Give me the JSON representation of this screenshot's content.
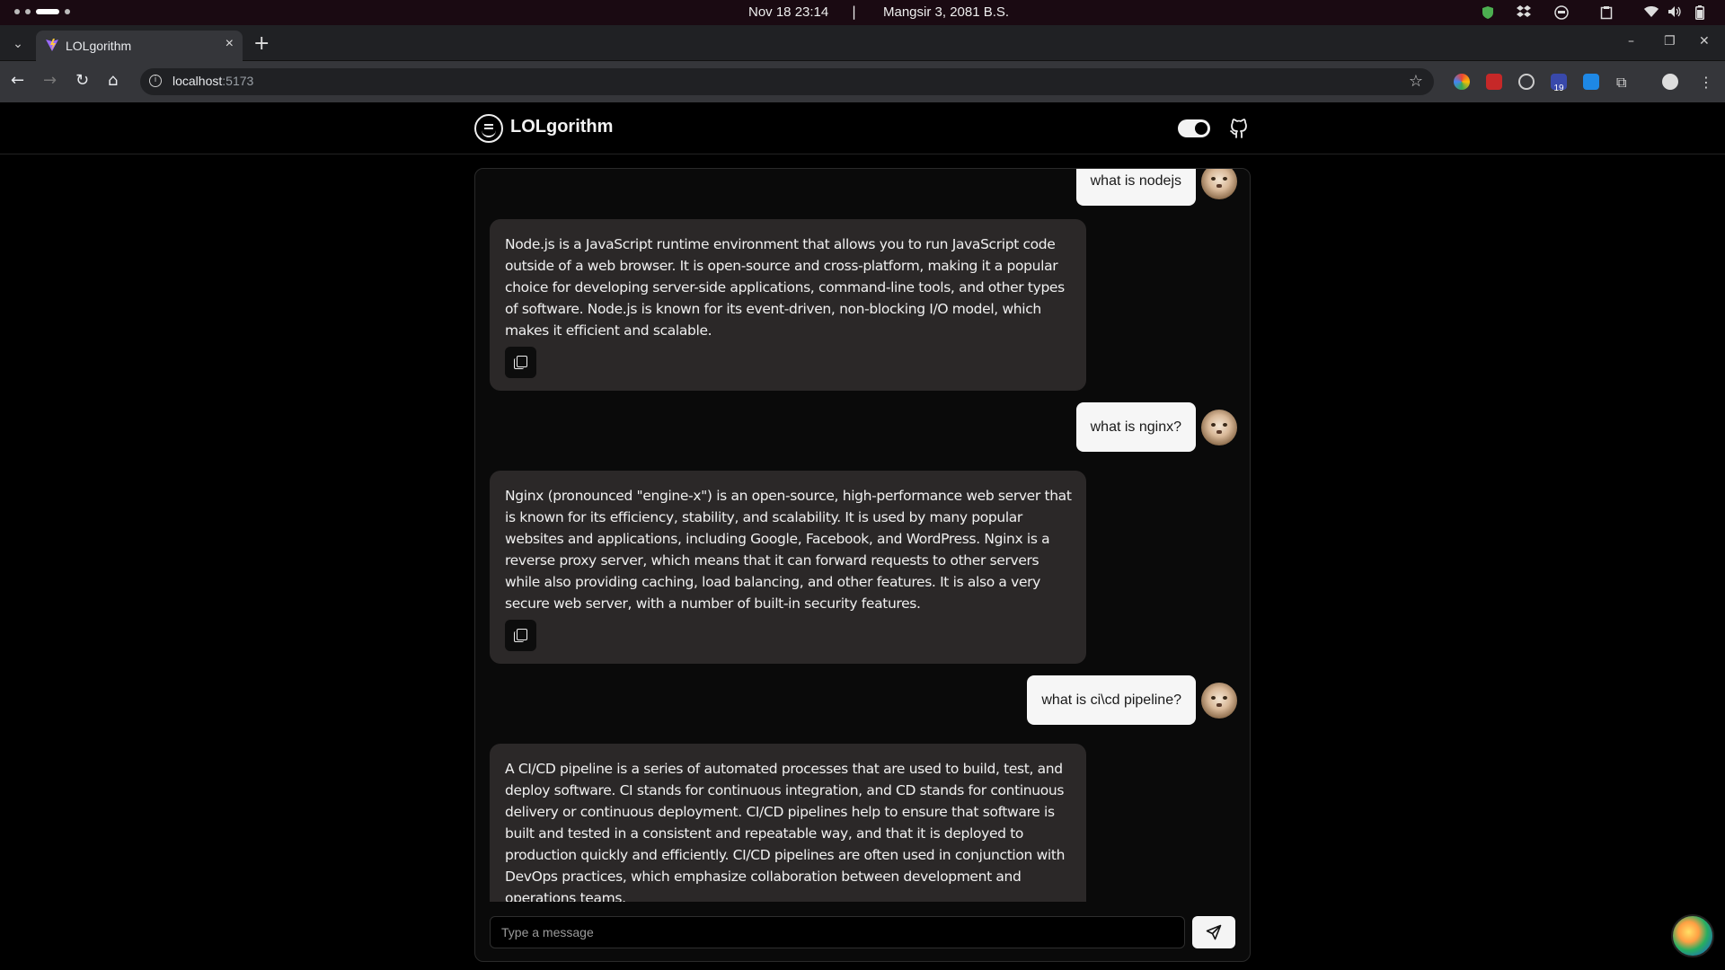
{
  "os": {
    "clock": "Nov 18  23:14",
    "separator": "|",
    "nepali_date": "Mangsir 3, 2081 B.S."
  },
  "browser": {
    "tab_title": "LOLgorithm",
    "url_host": "localhost",
    "url_port": ":5173",
    "extension_badge": "19"
  },
  "app": {
    "name": "LOLgorithm",
    "messages": [
      {
        "role": "user",
        "text": "what is nodejs"
      },
      {
        "role": "bot",
        "text": "Node.js is a JavaScript runtime environment that allows you to run JavaScript code outside of a web browser. It is open-source and cross-platform, making it a popular choice for developing server-side applications, command-line tools, and other types of software. Node.js is known for its event-driven, non-blocking I/O model, which makes it efficient and scalable."
      },
      {
        "role": "user",
        "text": "what is nginx?"
      },
      {
        "role": "bot",
        "text": "Nginx (pronounced \"engine-x\") is an open-source, high-performance web server that is known for its efficiency, stability, and scalability. It is used by many popular websites and applications, including Google, Facebook, and WordPress. Nginx is a reverse proxy server, which means that it can forward requests to other servers while also providing caching, load balancing, and other features. It is also a very secure web server, with a number of built-in security features."
      },
      {
        "role": "user",
        "text": "what is ci\\cd pipeline?"
      },
      {
        "role": "bot",
        "text": "A CI/CD pipeline is a series of automated processes that are used to build, test, and deploy software. CI stands for continuous integration, and CD stands for continuous delivery or continuous deployment. CI/CD pipelines help to ensure that software is built and tested in a consistent and repeatable way, and that it is deployed to production quickly and efficiently. CI/CD pipelines are often used in conjunction with DevOps practices, which emphasize collaboration between development and operations teams."
      }
    ],
    "input_placeholder": "Type a message"
  }
}
